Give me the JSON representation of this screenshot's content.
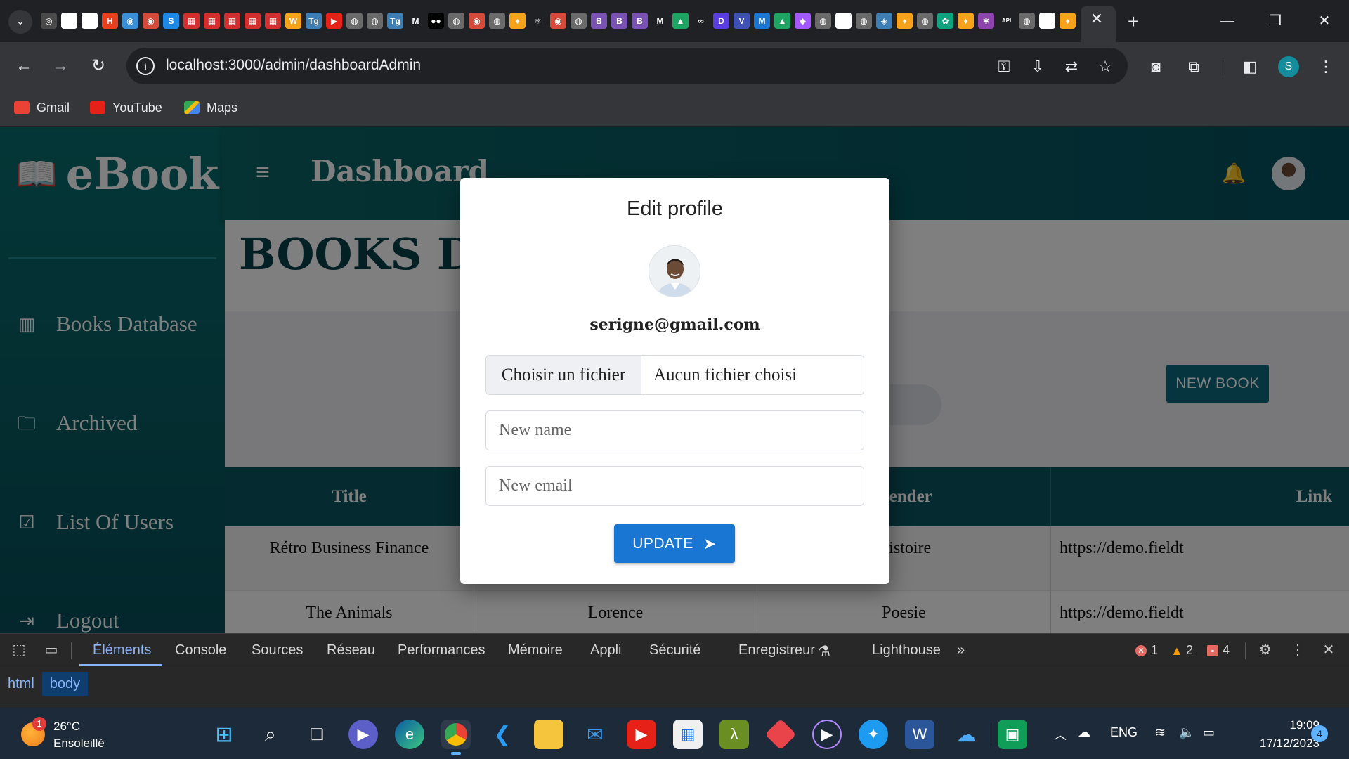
{
  "browser": {
    "favicons": [
      {
        "name": "chrome-tab-icon",
        "glyph": "◎",
        "color": "#4a4a4a"
      },
      {
        "name": "drive-tab-icon",
        "glyph": "▲",
        "color": "#ffffff"
      },
      {
        "name": "github-tab-icon",
        "glyph": "●",
        "color": "#ffffff"
      },
      {
        "name": "h-tab-icon",
        "glyph": "H",
        "color": "#e8401c"
      },
      {
        "name": "web-tab-icon",
        "glyph": "◉",
        "color": "#3b8fd6"
      },
      {
        "name": "web-tab-icon",
        "glyph": "◉",
        "color": "#d64a3b"
      },
      {
        "name": "s-tab-icon",
        "glyph": "S",
        "color": "#1e88e5"
      },
      {
        "name": "grid-tab-icon",
        "glyph": "▦",
        "color": "#d32f2f"
      },
      {
        "name": "grid-tab-icon",
        "glyph": "▦",
        "color": "#d32f2f"
      },
      {
        "name": "grid-tab-icon",
        "glyph": "▦",
        "color": "#d32f2f"
      },
      {
        "name": "grid-tab-icon",
        "glyph": "▦",
        "color": "#d32f2f"
      },
      {
        "name": "grid-tab-icon",
        "glyph": "▦",
        "color": "#d32f2f"
      },
      {
        "name": "w-tab-icon",
        "glyph": "W",
        "color": "#f6a21a"
      },
      {
        "name": "tg-tab-icon",
        "glyph": "Tg",
        "color": "#3d7fb5"
      },
      {
        "name": "youtube-tab-icon",
        "glyph": "▶",
        "color": "#e62117"
      },
      {
        "name": "globe-tab-icon",
        "glyph": "◍",
        "color": "#6a6a6a"
      },
      {
        "name": "globe-tab-icon",
        "glyph": "◍",
        "color": "#6a6a6a"
      },
      {
        "name": "tg-tab-icon",
        "glyph": "Tg",
        "color": "#3d7fb5"
      },
      {
        "name": "medium-tab-icon",
        "glyph": "M",
        "color": "#202124"
      },
      {
        "name": "medium-tab-icon",
        "glyph": "●●",
        "color": "#000000"
      },
      {
        "name": "globe-tab-icon",
        "glyph": "◍",
        "color": "#6a6a6a"
      },
      {
        "name": "web-tab-icon",
        "glyph": "◉",
        "color": "#d64a3b"
      },
      {
        "name": "globe-tab-icon",
        "glyph": "◍",
        "color": "#6a6a6a"
      },
      {
        "name": "firebase-tab-icon",
        "glyph": "♦",
        "color": "#f6a21a"
      },
      {
        "name": "react-tab-icon",
        "glyph": "⚛",
        "color": "#202124"
      },
      {
        "name": "web-tab-icon",
        "glyph": "◉",
        "color": "#d64a3b"
      },
      {
        "name": "globe-tab-icon",
        "glyph": "◍",
        "color": "#6a6a6a"
      },
      {
        "name": "bootstrap-tab-icon",
        "glyph": "B",
        "color": "#7952b3"
      },
      {
        "name": "bootstrap-tab-icon",
        "glyph": "B",
        "color": "#7952b3"
      },
      {
        "name": "bootstrap-tab-icon",
        "glyph": "B",
        "color": "#7952b3"
      },
      {
        "name": "medium-tab-icon",
        "glyph": "M",
        "color": "#202124"
      },
      {
        "name": "drive-tab-icon",
        "glyph": "▲",
        "color": "#1fa463"
      },
      {
        "name": "infinity-tab-icon",
        "glyph": "∞",
        "color": "#202124"
      },
      {
        "name": "d-tab-icon",
        "glyph": "D",
        "color": "#5b3ee0"
      },
      {
        "name": "v-tab-icon",
        "glyph": "V",
        "color": "#3f51b5"
      },
      {
        "name": "mui-tab-icon",
        "glyph": "M",
        "color": "#1976d2"
      },
      {
        "name": "drive-tab-icon",
        "glyph": "▲",
        "color": "#1fa463"
      },
      {
        "name": "figma-tab-icon",
        "glyph": "◆",
        "color": "#a259ff"
      },
      {
        "name": "globe-tab-icon",
        "glyph": "◍",
        "color": "#6a6a6a"
      },
      {
        "name": "github-tab-icon",
        "glyph": "●",
        "color": "#ffffff"
      },
      {
        "name": "globe-tab-icon",
        "glyph": "◍",
        "color": "#6a6a6a"
      },
      {
        "name": "cube-tab-icon",
        "glyph": "◈",
        "color": "#3d7fb5"
      },
      {
        "name": "firebase-tab-icon",
        "glyph": "♦",
        "color": "#f6a21a"
      },
      {
        "name": "globe-tab-icon",
        "glyph": "◍",
        "color": "#6a6a6a"
      },
      {
        "name": "openai-tab-icon",
        "glyph": "✿",
        "color": "#10a37f"
      },
      {
        "name": "firebase-tab-icon",
        "glyph": "♦",
        "color": "#f6a21a"
      },
      {
        "name": "gear-tab-icon",
        "glyph": "✱",
        "color": "#8e44ad"
      },
      {
        "name": "api-tab-icon",
        "glyph": "API",
        "color": "#202124"
      },
      {
        "name": "globe-tab-icon",
        "glyph": "◍",
        "color": "#6a6a6a"
      },
      {
        "name": "github-tab-icon",
        "glyph": "●",
        "color": "#ffffff"
      },
      {
        "name": "firebase-tab-icon",
        "glyph": "♦",
        "color": "#f6a21a"
      }
    ],
    "url": "localhost:3000/admin/dashboardAdmin",
    "profile_initial": "S",
    "bookmarks": [
      {
        "label": "Gmail",
        "color": "#ea4335"
      },
      {
        "label": "YouTube",
        "color": "#e62117"
      },
      {
        "label": "Maps",
        "color": "#34a853"
      }
    ]
  },
  "app": {
    "brand": "eBook",
    "topbar_title": "Dashboard",
    "sidebar": [
      {
        "label": "Books Database",
        "icon": "chart-icon"
      },
      {
        "label": "Archived",
        "icon": "folder-icon"
      },
      {
        "label": "List Of Users",
        "icon": "checklist-icon"
      },
      {
        "label": "Logout",
        "icon": "logout-icon"
      }
    ],
    "page_heading": "BOOKS DA",
    "new_book_label": "NEW BOOK",
    "table": {
      "headers": [
        "Title",
        "",
        "Gender",
        "Link"
      ],
      "rows": [
        [
          "Rétro Business Finance",
          "",
          "Histoire",
          "https://demo.fieldt"
        ],
        [
          "The Animals",
          "Lorence",
          "Poesie",
          "https://demo.fieldt"
        ]
      ]
    }
  },
  "modal": {
    "title": "Edit profile",
    "email": "serigne@gmail.com",
    "file_button": "Choisir un fichier",
    "file_status": "Aucun fichier choisi",
    "name_placeholder": "New name",
    "email_placeholder": "New email",
    "submit_label": "UPDATE"
  },
  "devtools": {
    "tabs": [
      "Éléments",
      "Console",
      "Sources",
      "Réseau",
      "Performances",
      "Mémoire",
      "Appli",
      "Sécurité",
      "Enregistreur",
      "Lighthouse"
    ],
    "errors": "1",
    "warnings": "2",
    "issues": "4",
    "breadcrumbs": [
      "html",
      "body"
    ]
  },
  "taskbar": {
    "weather_badge": "1",
    "temperature": "26°C",
    "condition": "Ensoleillé",
    "language": "ENG",
    "time": "19:09",
    "date": "17/12/2023",
    "notifications": "4"
  }
}
